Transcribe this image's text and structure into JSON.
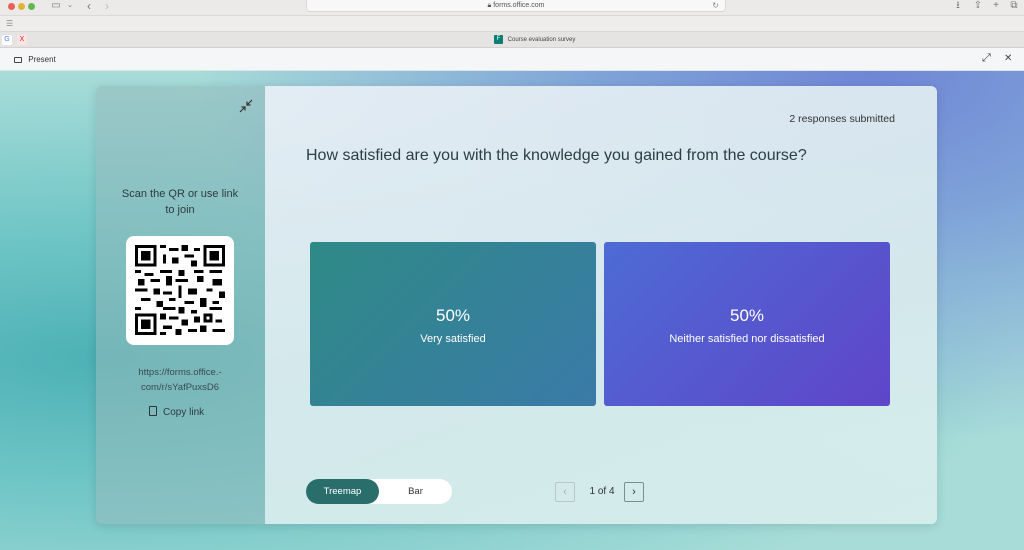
{
  "browser": {
    "url": "forms.office.com",
    "active_tab_title": "Course evaluation survey",
    "tab_favicons": [
      "G",
      "X"
    ]
  },
  "toolbar": {
    "present_label": "Present"
  },
  "join": {
    "instructions": "Scan the QR or use link to join",
    "link": "https://forms.office.-com/r/sYafPuxsD6",
    "copy_link_label": "Copy link"
  },
  "survey": {
    "responses": "2 responses submitted",
    "question": "How satisfied are you with the knowledge you gained from the course?",
    "results": [
      {
        "percent": "50%",
        "label": "Very satisfied",
        "color": "#2f8a86"
      },
      {
        "percent": "50%",
        "label": "Neither satisfied nor dissatisfied",
        "color": "#5559cf"
      }
    ]
  },
  "view_toggle": {
    "options": [
      "Treemap",
      "Bar"
    ],
    "selected": "Treemap"
  },
  "pager": {
    "text": "1 of 4",
    "prev": "‹",
    "next": "›"
  },
  "icons": {
    "share": "⇪",
    "download": "⭳",
    "new_tab": "+",
    "tabs": "⧉",
    "expand": "⤢",
    "close": "✕"
  }
}
